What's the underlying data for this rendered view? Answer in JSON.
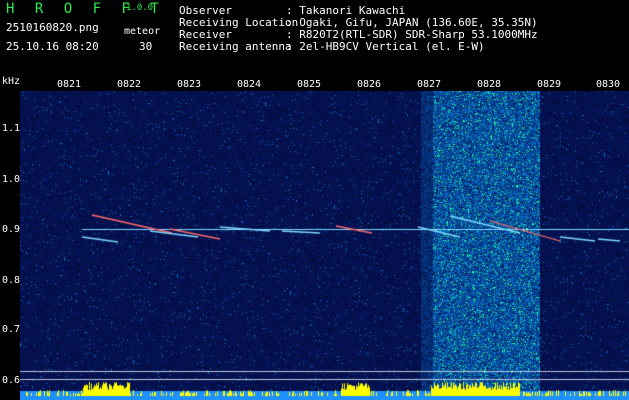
{
  "header": {
    "app_title": "H R O F F T",
    "version": "1.0.0",
    "filename": "2510160820.png",
    "meteor_label": "meteor",
    "datetime": "25.10.16 08:20",
    "meteor_count": "30"
  },
  "info": [
    {
      "key": "Observer",
      "value": ": Takanori Kawachi"
    },
    {
      "key": "Receiving Location",
      "value": ": Ogaki, Gifu, JAPAN (136.60E, 35.35N)"
    },
    {
      "key": "Receiver",
      "value": ": R820T2(RTL-SDR) SDR-Sharp 53.1000MHz"
    },
    {
      "key": "Receiving antenna",
      "value": ": 2el-HB9CV Vertical (el. E-W)"
    }
  ],
  "axes": {
    "y_unit": "kHz",
    "x_ticks": [
      "0821",
      "0822",
      "0823",
      "0824",
      "0825",
      "0826",
      "0827",
      "0828",
      "0829",
      "0830"
    ],
    "y_ticks": [
      "1.1",
      "1.0",
      "0.9",
      "0.8",
      "0.7",
      "0.6"
    ]
  },
  "colors": {
    "title": "#2ee84f",
    "background": "#000000",
    "noise_floor": "#0a0f5a",
    "carrier": "#7fd8ff",
    "echo": "#ff6b6b",
    "power_bar": "#ffff00",
    "power_base": "#1e90ff"
  }
}
